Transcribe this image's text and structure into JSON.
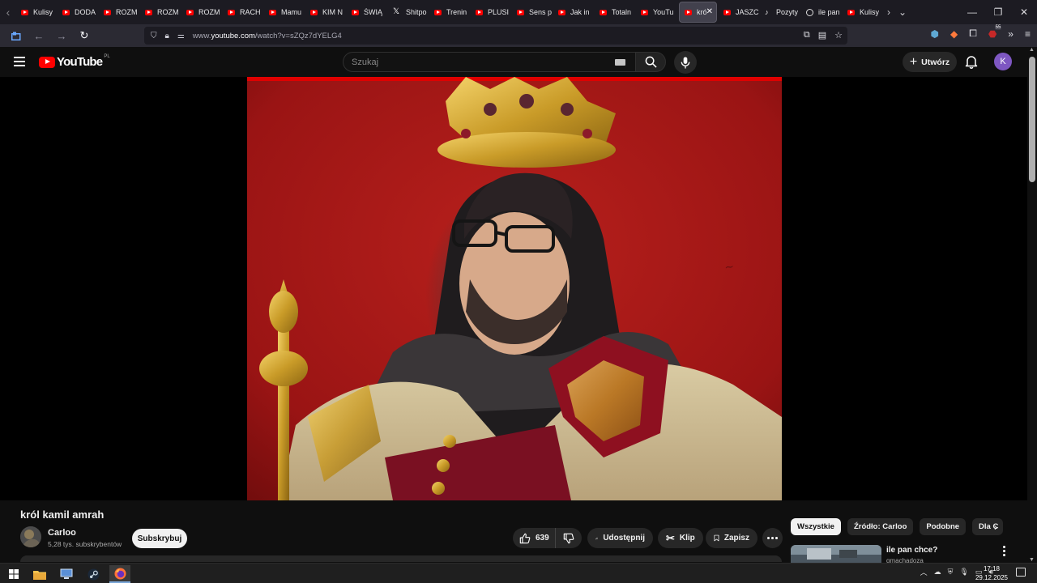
{
  "browser": {
    "tabs": [
      {
        "label": "Kulisy",
        "icon": "youtube-icon"
      },
      {
        "label": "DODA",
        "icon": "youtube-icon"
      },
      {
        "label": "ROZM",
        "icon": "youtube-icon"
      },
      {
        "label": "ROZM",
        "icon": "youtube-icon"
      },
      {
        "label": "ROZM",
        "icon": "youtube-icon"
      },
      {
        "label": "RACH",
        "icon": "youtube-icon"
      },
      {
        "label": "Mamu",
        "icon": "youtube-icon"
      },
      {
        "label": "KIM N",
        "icon": "youtube-icon"
      },
      {
        "label": "ŚWIĄ",
        "icon": "youtube-icon"
      },
      {
        "label": "Shitpo",
        "icon": "x-icon"
      },
      {
        "label": "Trenin",
        "icon": "youtube-icon"
      },
      {
        "label": "PLUSI",
        "icon": "youtube-icon"
      },
      {
        "label": "Sens p",
        "icon": "youtube-icon"
      },
      {
        "label": "Jak in",
        "icon": "youtube-icon"
      },
      {
        "label": "Totaln",
        "icon": "youtube-icon"
      },
      {
        "label": "YouTu",
        "icon": "youtube-icon"
      },
      {
        "label": "kró",
        "icon": "youtube-icon",
        "active": true
      },
      {
        "label": "JASZC",
        "icon": "youtube-icon"
      },
      {
        "label": "Pozyty",
        "icon": "tiktok-icon"
      },
      {
        "label": "ile pan",
        "icon": "radio-icon"
      },
      {
        "label": "Kulisy",
        "icon": "youtube-icon"
      }
    ],
    "url_dim": "www.",
    "url_host": "youtube.com",
    "url_path": "/watch?v=sZQz7dYELG4",
    "extension_badge": "55"
  },
  "youtube": {
    "logo_text": "YouTube",
    "region": "PL",
    "search_placeholder": "Szukaj",
    "create_label": "Utwórz",
    "avatar_letter": "K"
  },
  "video": {
    "title": "król kamil amrah",
    "channel_name": "Carloo",
    "subscribers": "5,28 tys. subskrybentów",
    "subscribe_label": "Subskrybuj",
    "likes": "639",
    "share_label": "Udostępnij",
    "clip_label": "Klip",
    "save_label": "Zapisz"
  },
  "chips": [
    "Wszystkie",
    "Źródło: Carloo",
    "Podobne",
    "Dla C"
  ],
  "recommended": {
    "title": "ile pan chce?",
    "channel": "gmachadoza"
  },
  "taskbar": {
    "time": "17:18",
    "date": "29.12.2025"
  },
  "colors": {
    "youtube_red": "#ff0000",
    "page_bg": "#0f0f0f",
    "avatar_purple": "#7e57c2"
  }
}
